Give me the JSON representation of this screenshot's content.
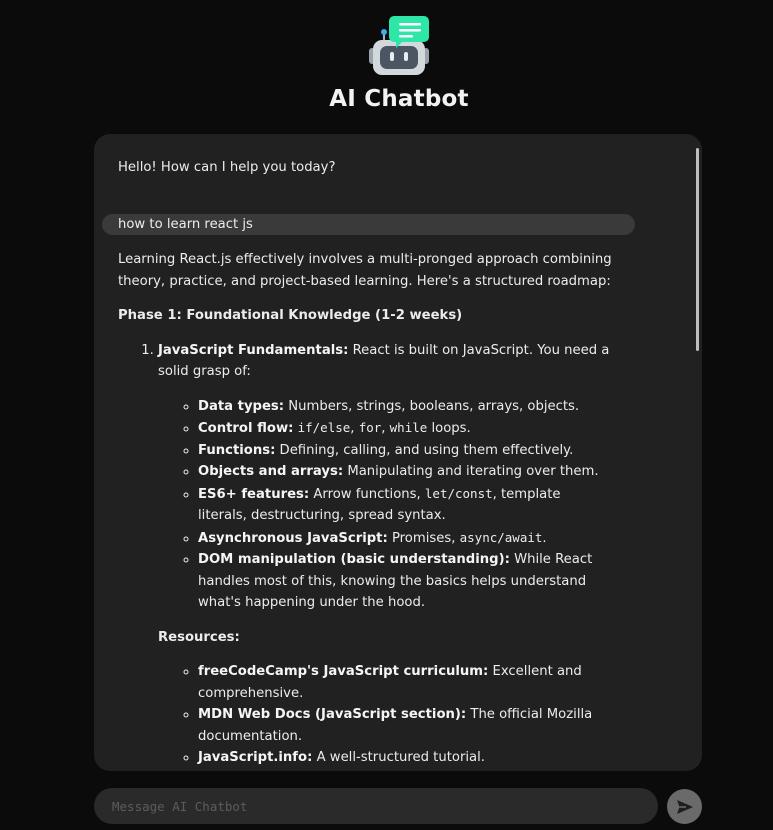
{
  "app": {
    "title": "AI Chatbot",
    "logo_icon": "robot-chat-icon"
  },
  "colors": {
    "background": "#0b0b0b",
    "panel": "#212121",
    "user_bubble": "#3a3a3a",
    "logo_accent": "#2ee6a8"
  },
  "messages": {
    "greeting": "Hello! How can I help you today?",
    "user": "how to learn react js",
    "answer": {
      "intro": "Learning React.js effectively involves a multi-pronged approach combining theory, practice, and project-based learning. Here's a structured roadmap:",
      "phase1": "Phase 1: Foundational Knowledge (1-2 weeks)",
      "item1_title": "JavaScript Fundamentals:",
      "item1_text": " React is built on JavaScript. You need a solid grasp of:",
      "topics": {
        "t1_title": "Data types:",
        "t1_text": " Numbers, strings, booleans, arrays, objects.",
        "t2_title": "Control flow:",
        "t2_code1": "if/else",
        "t2_sep1": ", ",
        "t2_code2": "for",
        "t2_sep2": ", ",
        "t2_code3": "while",
        "t2_text": " loops.",
        "t3_title": "Functions:",
        "t3_text": " Defining, calling, and using them effectively.",
        "t4_title": "Objects and arrays:",
        "t4_text": " Manipulating and iterating over them.",
        "t5_title": "ES6+ features:",
        "t5_text1": " Arrow functions, ",
        "t5_code": "let/const",
        "t5_text2": ", template literals, destructuring, spread syntax.",
        "t6_title": "Asynchronous JavaScript:",
        "t6_text1": " Promises, ",
        "t6_code": "async/await",
        "t6_text2": ".",
        "t7_title": "DOM manipulation (basic understanding):",
        "t7_text": " While React handles most of this, knowing the basics helps understand what's happening under the hood."
      },
      "resources_label": "Resources:",
      "resources": {
        "r1_title": "freeCodeCamp's JavaScript curriculum:",
        "r1_text": " Excellent and comprehensive.",
        "r2_title": "MDN Web Docs (JavaScript section):",
        "r2_text": " The official Mozilla documentation.",
        "r3_title": "JavaScript.info:",
        "r3_text": " A well-structured tutorial."
      }
    }
  },
  "composer": {
    "placeholder": "Message AI Chatbot",
    "send_icon": "send-arrow-icon"
  }
}
